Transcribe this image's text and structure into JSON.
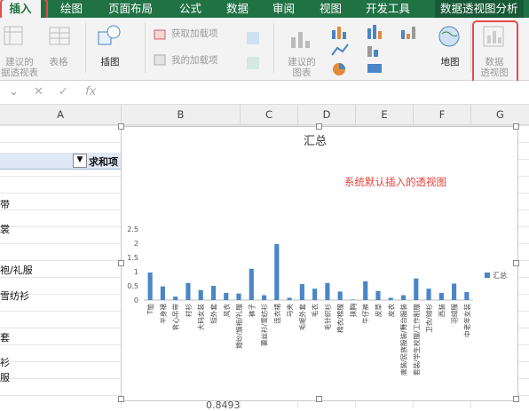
{
  "tabs": [
    "插入",
    "绘图",
    "页面布局",
    "公式",
    "数据",
    "审阅",
    "视图",
    "开发工具",
    "数据透视图分析"
  ],
  "ribbon": {
    "recommended_pivot_l1": "建议的",
    "recommended_pivot_l2": "据透视表",
    "table": "表格",
    "illustrations": "插图",
    "get_addins": "获取加载项",
    "my_addins": "我的加载项",
    "recommended_charts_l1": "建议的",
    "recommended_charts_l2": "图表",
    "map": "地图",
    "pivot_chart_l1": "数据",
    "pivot_chart_l2": "透视图"
  },
  "formula_bar": {
    "cancel": "✕",
    "enter": "✓",
    "fx": "fx",
    "value": ""
  },
  "columns": [
    "A",
    "B",
    "C",
    "D",
    "E",
    "F",
    "G"
  ],
  "sheet": {
    "pivot_header": "求和项",
    "row_fragments": [
      "带",
      "裳",
      "袍/礼服",
      "雪纺衫",
      "套",
      "衫",
      "服"
    ],
    "bottom_value": "0.8493"
  },
  "annotation": "系统默认插入的透视图",
  "colors": {
    "ribbon_green": "#207245",
    "bar": "#4a86c5",
    "annotation": "#e8403a"
  },
  "chart_data": {
    "type": "bar",
    "title": "汇总",
    "legend": [
      "汇总"
    ],
    "legend_position": "right",
    "ylim": [
      0,
      2.5
    ],
    "yticks": [
      0,
      0.5,
      1,
      1.5,
      2,
      2.5
    ],
    "grid": false,
    "categories": [
      "T恤",
      "半身裙",
      "背心吊带",
      "衬衫",
      "大码女装",
      "短外套",
      "风衣",
      "婚纱/旗袍/礼服",
      "裤子",
      "蕾丝衫/雪纺衫",
      "连衣裙",
      "马夹",
      "毛呢外套",
      "毛衣",
      "毛针织衫",
      "棉衣/棉服",
      "抹胸",
      "牛仔裤",
      "皮草",
      "皮衣",
      "唐装/民族服装/舞台服装",
      "套装/学生校服/工作制服",
      "卫衣/绒衫",
      "西装",
      "羽绒服",
      "中老年女装"
    ],
    "values": [
      0.97,
      0.48,
      0.12,
      0.6,
      0.35,
      0.5,
      0.25,
      0.23,
      1.1,
      0.17,
      1.97,
      0.08,
      0.56,
      0.4,
      0.6,
      0.3,
      0.02,
      0.66,
      0.32,
      0.08,
      0.17,
      0.76,
      0.4,
      0.25,
      0.58,
      0.28
    ]
  }
}
